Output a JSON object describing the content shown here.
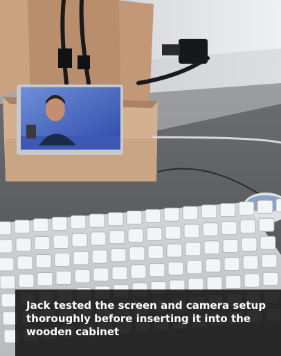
{
  "photo": {
    "subject": "small display in cardboard box showing a video call, keyboard and mouse on desk"
  },
  "caption": {
    "text": "Jack tested the screen and camera setup thoroughly before inserting it into the wooden cabinet"
  },
  "colors": {
    "caption_background": "#121212",
    "caption_text": "#ffffff"
  }
}
